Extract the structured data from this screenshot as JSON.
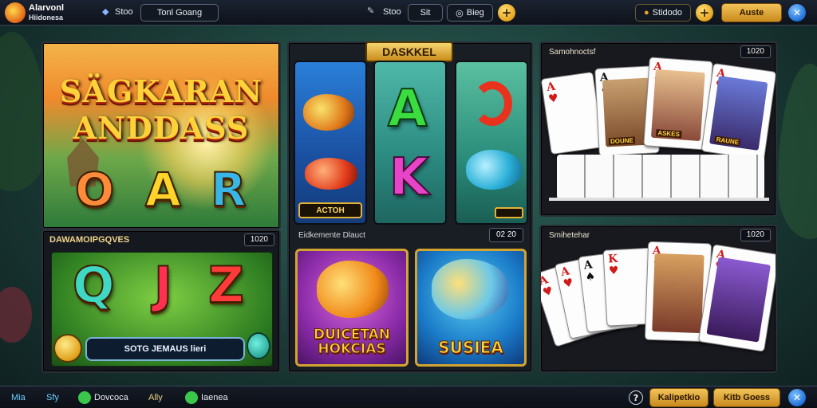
{
  "topbar": {
    "brand_line1": "Alarvonl",
    "brand_line2": "Hiidonesa",
    "balance_label": "Stoo",
    "search_value": "Tonl Goang",
    "btn_stoo": "Stoo",
    "btn_sit": "Sit",
    "btn_bieg": "Bieg",
    "plus_label": "+",
    "account_label": "Stidodo",
    "plus2_label": "+",
    "cta_label": "Auste",
    "close_label": "✕"
  },
  "hero": {
    "title_line1": "SÄGKARAN",
    "title_line2": "ANDDASS",
    "letters": [
      "O",
      "A",
      "R"
    ]
  },
  "left_bottom": {
    "header": "DAWAMOIPGQVES",
    "tag": "1020",
    "letters": [
      "Q",
      "J",
      "Z"
    ],
    "status": "SOTG JEMAUS lieri"
  },
  "middle": {
    "header": "DASKKEL",
    "reel_label": "ACTOH",
    "reel_letters": [
      "A",
      "K"
    ],
    "sub_header": "Eidkemente Dlauct",
    "tag": "02 20",
    "tile1_title": "DUICETAN HOKCIAS",
    "tile2_title": "SUSIEA"
  },
  "right_top": {
    "header": "Samohnoctsf",
    "tag": "1020",
    "face_caption_1": "DOUNE",
    "face_caption_2": "ASKES",
    "face_caption_3": "RAUNE"
  },
  "right_bottom": {
    "header": "Smihetehar",
    "tag": "1020"
  },
  "bottombar": {
    "item1": "Mia",
    "item2": "Sfy",
    "item3": "Dovcoca",
    "item4": "Ally",
    "item5": "Iaenea",
    "help_label": "?",
    "btn1": "Kalipetkio",
    "btn2": "Kitb Goess",
    "close_label": "✕"
  },
  "colors": {
    "gold": "#e5a31a",
    "panel_bg": "#1a1f28",
    "accent_blue": "#1f6fd6"
  }
}
